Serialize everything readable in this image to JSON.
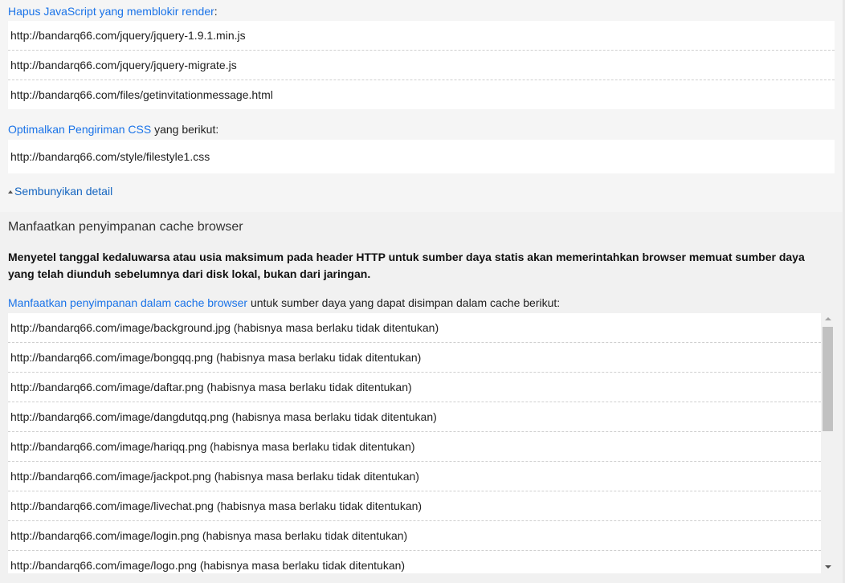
{
  "render_blocking": {
    "link": "Hapus JavaScript yang memblokir render",
    "suffix": ":",
    "items": [
      "http://bandarq66.com/jquery/jquery-1.9.1.min.js",
      "http://bandarq66.com/jquery/jquery-migrate.js",
      "http://bandarq66.com/files/getinvitationmessage.html"
    ]
  },
  "css_delivery": {
    "link": "Optimalkan Pengiriman CSS",
    "suffix": " yang berikut:",
    "items": [
      "http://bandarq66.com/style/filestyle1.css"
    ]
  },
  "toggle_label": "Sembunyikan detail",
  "cache": {
    "title": "Manfaatkan penyimpanan cache browser",
    "description": "Menyetel tanggal kedaluwarsa atau usia maksimum pada header HTTP untuk sumber daya statis akan memerintahkan browser memuat sumber daya yang telah diunduh sebelumnya dari disk lokal, bukan dari jaringan.",
    "link": "Manfaatkan penyimpanan dalam cache browser",
    "suffix": " untuk sumber daya yang dapat disimpan dalam cache berikut:",
    "items": [
      "http://bandarq66.com/image/background.jpg (habisnya masa berlaku tidak ditentukan)",
      "http://bandarq66.com/image/bongqq.png (habisnya masa berlaku tidak ditentukan)",
      "http://bandarq66.com/image/daftar.png (habisnya masa berlaku tidak ditentukan)",
      "http://bandarq66.com/image/dangdutqq.png (habisnya masa berlaku tidak ditentukan)",
      "http://bandarq66.com/image/hariqq.png (habisnya masa berlaku tidak ditentukan)",
      "http://bandarq66.com/image/jackpot.png (habisnya masa berlaku tidak ditentukan)",
      "http://bandarq66.com/image/livechat.png (habisnya masa berlaku tidak ditentukan)",
      "http://bandarq66.com/image/login.png (habisnya masa berlaku tidak ditentukan)",
      "http://bandarq66.com/image/logo.png (habisnya masa berlaku tidak ditentukan)"
    ]
  },
  "colors": {
    "link": "#1a73e8",
    "toggle": "#1565c0",
    "background": "#f5f5f5",
    "list_bg": "#ffffff"
  },
  "icons": {
    "toggle": "caret-up-icon",
    "scroll_up": "scroll-up-arrow-icon",
    "scroll_down": "scroll-down-arrow-icon"
  }
}
